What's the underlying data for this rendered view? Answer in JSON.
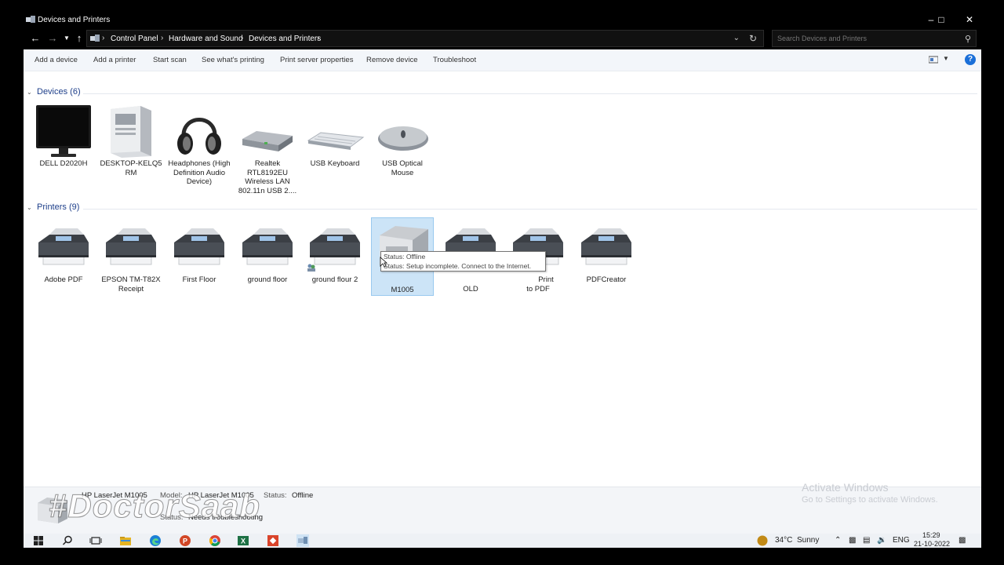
{
  "window": {
    "title": "Devices and Printers"
  },
  "address": {
    "crumbs": [
      "Control Panel",
      "Hardware and Sound",
      "Devices and Printers"
    ],
    "search_placeholder": "Search Devices and Printers"
  },
  "commands": [
    "Add a device",
    "Add a printer",
    "Start scan",
    "See what's printing",
    "Print server properties",
    "Remove device",
    "Troubleshoot"
  ],
  "devices_group": {
    "label": "Devices (6)",
    "items": [
      {
        "name": "DELL D2020H",
        "icon": "monitor-icon"
      },
      {
        "name": "DESKTOP-KELQ5 RM",
        "icon": "computer-tower-icon"
      },
      {
        "name": "Headphones (High Definition Audio Device)",
        "icon": "headphones-icon"
      },
      {
        "name": "Realtek RTL8192EU Wireless LAN 802.11n USB 2....",
        "icon": "network-adapter-icon"
      },
      {
        "name": "USB Keyboard",
        "icon": "keyboard-icon"
      },
      {
        "name": "USB Optical Mouse",
        "icon": "mouse-icon"
      }
    ]
  },
  "printers_group": {
    "label": "Printers (9)",
    "items": [
      {
        "name": "Adobe PDF",
        "icon": "printer-icon"
      },
      {
        "name": "EPSON TM-T82X Receipt",
        "icon": "printer-icon"
      },
      {
        "name": "First Floor",
        "icon": "printer-icon"
      },
      {
        "name": "ground floor",
        "icon": "printer-icon"
      },
      {
        "name": "ground flour 2",
        "icon": "printer-icon"
      },
      {
        "name": "M1005",
        "icon": "laserjet-printer-icon"
      },
      {
        "name": "OLD",
        "icon": "printer-icon"
      },
      {
        "name": "to PDF",
        "icon": "printer-icon",
        "name_line_top": "Print"
      },
      {
        "name": "PDFCreator",
        "icon": "printer-icon"
      }
    ]
  },
  "tooltip": {
    "line1": "Status: Offline",
    "line2": "Status: Setup incomplete. Connect to the Internet."
  },
  "details": {
    "device_name": "HP LaserJet M1005",
    "model_label": "Model:",
    "model_value": "HP LaserJet M1005",
    "status_label": "Status:",
    "status_value": "Offline",
    "status2_label": "Status:",
    "status2_value": "Needs troubleshooting",
    "watermark": "#DoctorSaab"
  },
  "activation": {
    "line1": "Activate Windows",
    "line2": "Go to Settings to activate Windows."
  },
  "taskbar": {
    "weather_temp": "34°C",
    "weather_text": "Sunny",
    "language": "ENG",
    "time": "15:29",
    "date": "21-10-2022"
  }
}
